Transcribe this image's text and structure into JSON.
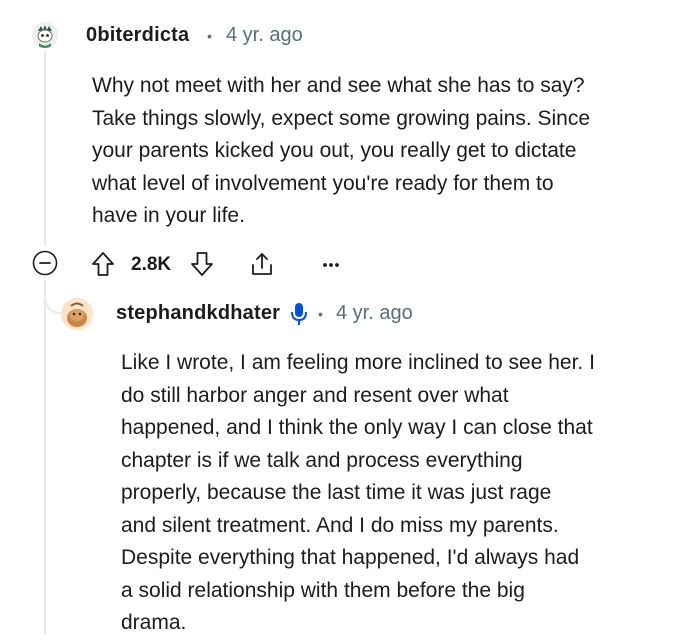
{
  "comment1": {
    "username": "0biterdicta",
    "separator": "•",
    "age": "4 yr. ago",
    "body": [
      "Why not meet with her and see what she has to say?",
      "Take things slowly, expect some growing pains. Since",
      "your parents kicked you out, you really get to dictate",
      "what level of involvement you're ready for them to",
      "have in your life."
    ],
    "score": "2.8K",
    "icons": [
      "collapse-icon",
      "upvote-icon",
      "downvote-icon",
      "share-icon",
      "more-icon"
    ]
  },
  "comment2": {
    "username": "stephandkdhater",
    "separator": "•",
    "age": "4 yr. ago",
    "badge_icon": "microphone-icon",
    "body": [
      "Like I wrote, I am feeling more inclined to see her. I",
      "do still harbor anger and resent over what",
      "happened, and I think the only way I can close that",
      "chapter is if we talk and process everything",
      "properly, because the last time it was just rage",
      "and silent treatment. And I do miss my parents.",
      "Despite everything that happened, I'd always had",
      "a solid relationship with them before the big",
      "drama."
    ]
  },
  "colors": {
    "text": "#1c1c1c",
    "meta": "#576f76",
    "thread": "#e6e8ea",
    "badge": "#0a4fd8"
  }
}
